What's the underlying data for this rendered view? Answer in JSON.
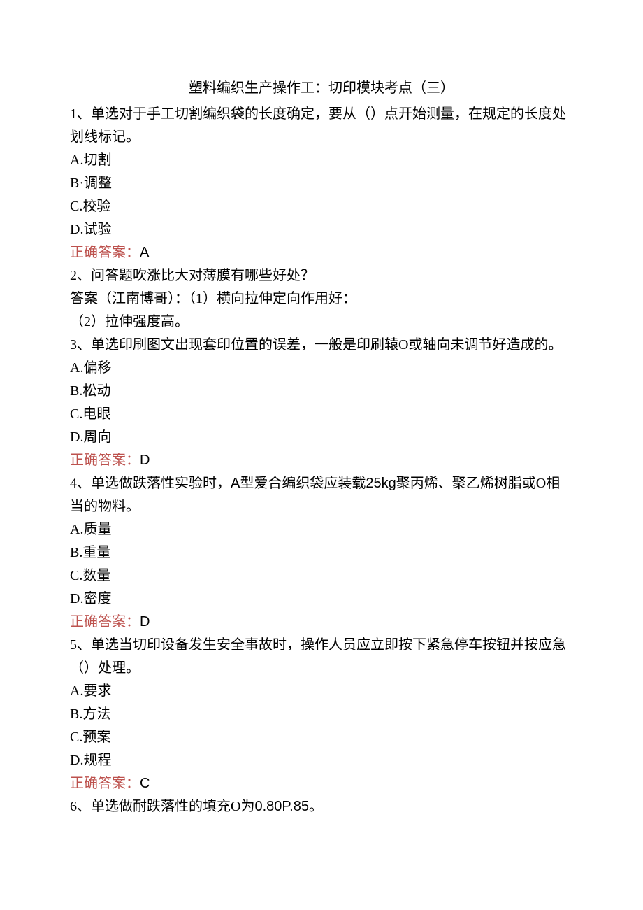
{
  "title": "塑料编织生产操作工：切印模块考点（三）",
  "q1": {
    "stem": "1、单选对于手工切割编织袋的长度确定，要从（）点开始测量，在规定的长度处划线标记。",
    "a": "A.切割",
    "b": "B·调整",
    "c": "C.校验",
    "d": "D.试验",
    "ans_label": "正确答案：",
    "ans_value": "A"
  },
  "q2": {
    "stem": "2、问答题吹涨比大对薄膜有哪些好处？",
    "ans1": "答案（江南博哥）：（1）横向拉伸定向作用好：",
    "ans2": "（2）拉伸强度高。"
  },
  "q3": {
    "stem": "3、单选印刷图文出现套印位置的误差，一般是印刷辕O或轴向未调节好造成的。",
    "a": "A.偏移",
    "b": "B.松动",
    "c": "C.电眼",
    "d": "D.周向",
    "ans_label": "正确答案：",
    "ans_value": "D"
  },
  "q4": {
    "stem_p1": "4、单选做跌落性实验时，",
    "stem_p2": "A",
    "stem_p3": "型爱合编织袋应装载",
    "stem_p4": "25kg",
    "stem_p5": "聚丙烯、聚乙烯树脂或O相当的物料。",
    "a": "A.质量",
    "b": "B.重量",
    "c": "C.数量",
    "d": "D.密度",
    "ans_label": "正确答案：",
    "ans_value": "D"
  },
  "q5": {
    "stem": "5、单选当切印设备发生安全事故时，操作人员应立即按下紧急停车按钮并按应急（）处理。",
    "a": "A.要求",
    "b": "B.方法",
    "c": "C.预案",
    "d": "D.规程",
    "ans_label": "正确答案：",
    "ans_value": "C"
  },
  "q6": {
    "stem_p1": "6、单选做耐跌落性的填充O为",
    "stem_p2": "0.80P.85",
    "stem_p3": "。"
  }
}
